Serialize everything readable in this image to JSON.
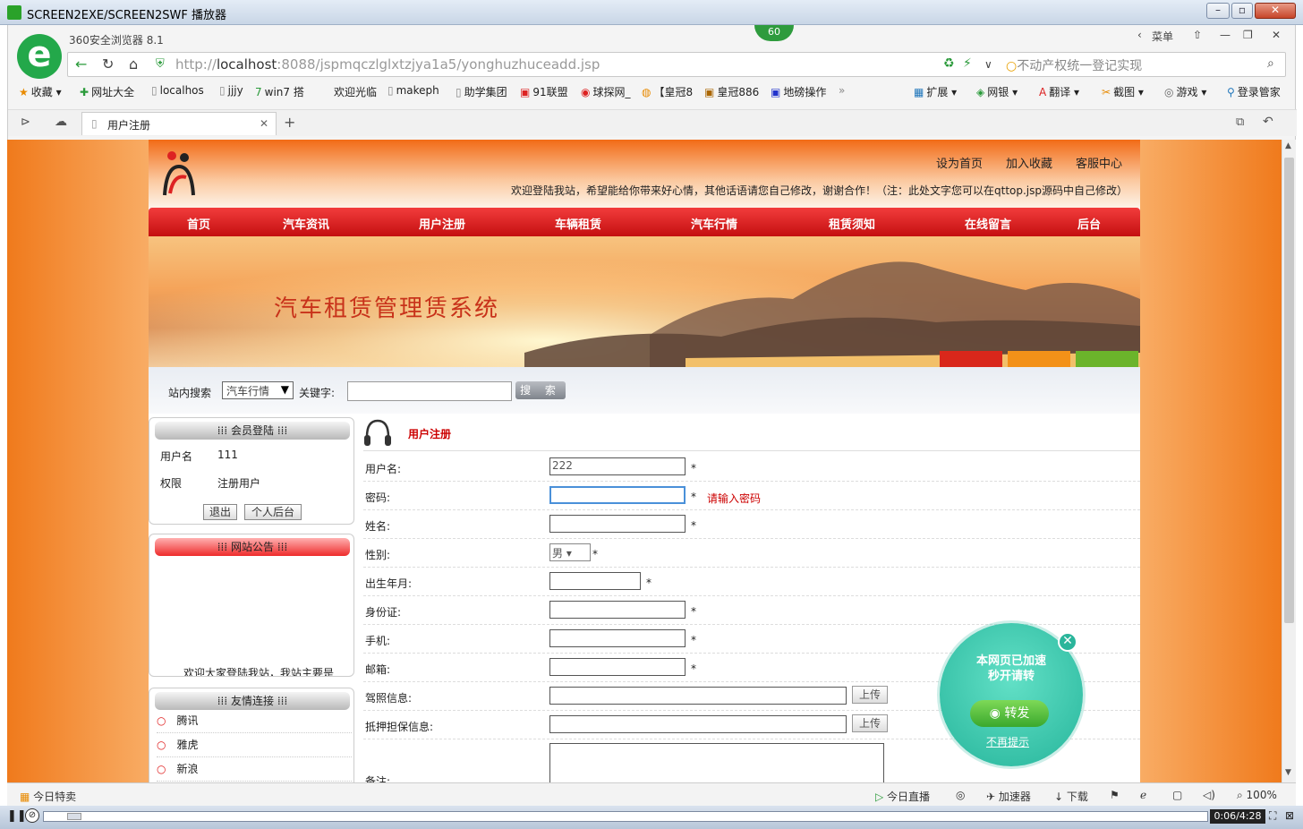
{
  "player": {
    "title": "SCREEN2EXE/SCREEN2SWF 播放器",
    "time": "0:06/4:28",
    "progress_fraction": 0.02
  },
  "browser": {
    "name": "360安全浏览器 8.1",
    "speed_badge": "60",
    "menu_label": "菜单",
    "url_prefix": "http://",
    "url_host": "localhost",
    "url_rest": ":8088/jspmqczlglxtzjya1a5/yonghuzhuceadd.jsp",
    "search_placeholder": "不动产权统一登记实现",
    "bookmarks": [
      "收藏",
      "网址大全",
      "localhos",
      "jjjy",
      "win7 搭",
      "欢迎光临",
      "makeph",
      "助学集团",
      "91联盟",
      "球探网_",
      "【皇冠8",
      "皇冠886",
      "地磅操作"
    ],
    "toolbar_right": [
      "扩展",
      "网银",
      "翻译",
      "截图",
      "游戏",
      "登录管家"
    ],
    "tab_title": "用户注册"
  },
  "site": {
    "top_links": [
      "设为首页",
      "加入收藏",
      "客服中心"
    ],
    "welcome": "欢迎登陆我站，希望能给你带来好心情，其他话语请您自己修改，谢谢合作！（注：此处文字您可以在qttop.jsp源码中自己修改）",
    "menu": [
      "首页",
      "汽车资讯",
      "用户注册",
      "车辆租赁",
      "汽车行情",
      "租赁须知",
      "在线留言",
      "后台"
    ],
    "banner_title": "汽车租赁管理赁系统",
    "search": {
      "label": "站内搜索",
      "select_value": "汽车行情",
      "kw_label": "关键字:",
      "button": "搜 索"
    }
  },
  "sidebar": {
    "member": {
      "title": "会员登陆",
      "username_label": "用户名",
      "username": "111",
      "role_label": "权限",
      "role": "注册用户",
      "logout": "退出",
      "personal": "个人后台"
    },
    "notice": {
      "title": "网站公告",
      "text": "欢迎大家登陆我站，我站主要是"
    },
    "links": {
      "title": "友情连接",
      "items": [
        "腾讯",
        "雅虎",
        "新浪"
      ]
    }
  },
  "form": {
    "title": "用户注册",
    "fields": [
      {
        "label": "用户名:",
        "value": "222",
        "star": "*"
      },
      {
        "label": "密码:",
        "value": "",
        "star": "*",
        "error": "请输入密码"
      },
      {
        "label": "姓名:",
        "value": "",
        "star": "*"
      },
      {
        "label": "性别:",
        "value": "男",
        "star": "*"
      },
      {
        "label": "出生年月:",
        "value": "",
        "star": "*"
      },
      {
        "label": "身份证:",
        "value": "",
        "star": "*"
      },
      {
        "label": "手机:",
        "value": "",
        "star": "*"
      },
      {
        "label": "邮箱:",
        "value": "",
        "star": "*"
      },
      {
        "label": "驾照信息:",
        "value": "",
        "upload": "上传"
      },
      {
        "label": "抵押担保信息:",
        "value": "",
        "upload": "上传"
      },
      {
        "label": "备注:",
        "value": ""
      }
    ]
  },
  "share": {
    "line1": "本网页已加速",
    "line2": "秒开请转",
    "forward": "转发",
    "dismiss": "不再提示"
  },
  "statusbar": {
    "left": "今日特卖",
    "live": "今日直播",
    "accel": "加速器",
    "download": "下载",
    "zoom": "100%"
  }
}
